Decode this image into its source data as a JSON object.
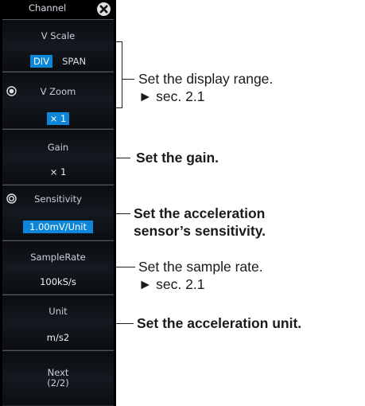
{
  "menu": {
    "title": "Channel",
    "vscale": {
      "label": "V Scale",
      "options": [
        "DIV",
        "SPAN"
      ],
      "selected": "DIV"
    },
    "vzoom": {
      "label": "V Zoom",
      "value": "× 1"
    },
    "gain": {
      "label": "Gain",
      "value": "× 1"
    },
    "sensitivity": {
      "label": "Sensitivity",
      "value": "1.00mV/Unit"
    },
    "samplerate": {
      "label": "SampleRate",
      "value": "100kS/s"
    },
    "unit": {
      "label": "Unit",
      "value": "m/s2"
    },
    "next": {
      "line1": "Next",
      "line2": "(2/2)"
    }
  },
  "callouts": {
    "display_range": {
      "line1": "Set the display range.",
      "line2": "► sec. 2.1"
    },
    "gain": "Set the gain.",
    "sensitivity": {
      "line1": "Set the acceleration",
      "line2": "sensor’s sensitivity."
    },
    "sample_rate": {
      "line1": "Set the sample rate.",
      "line2": "► sec. 2.1"
    },
    "unit": "Set the acceleration unit."
  },
  "colors": {
    "highlight": "#0c86d8",
    "panel": "#000000"
  },
  "icons": [
    "close-icon",
    "knob-icon"
  ]
}
